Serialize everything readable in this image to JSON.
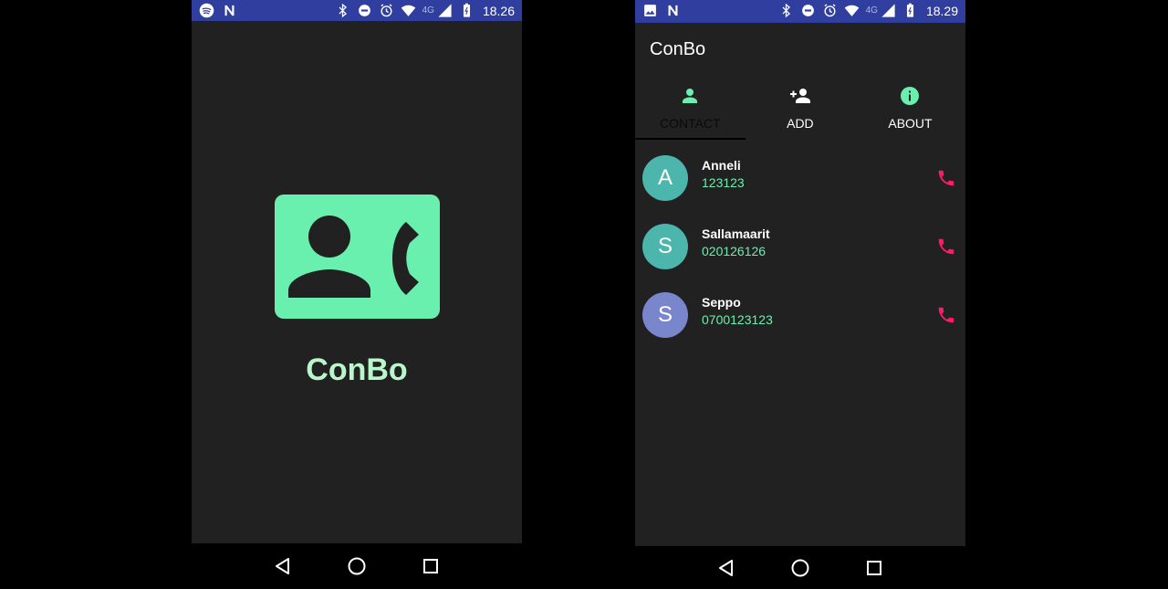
{
  "splash": {
    "status": {
      "time": "18.26",
      "network": "4G"
    },
    "app_name": "ConBo"
  },
  "main": {
    "status": {
      "time": "18.29",
      "network": "4G"
    },
    "app_title": "ConBo",
    "tabs": [
      {
        "label": "CONTACT",
        "icon": "person-icon",
        "active": true
      },
      {
        "label": "ADD",
        "icon": "person-add-icon",
        "active": false
      },
      {
        "label": "ABOUT",
        "icon": "info-icon",
        "active": false
      }
    ],
    "contacts": [
      {
        "initial": "A",
        "name": "Anneli",
        "number": "123123",
        "avatar_color": "#4db6ac"
      },
      {
        "initial": "S",
        "name": "Sallamaarit",
        "number": "020126126",
        "avatar_color": "#4db6ac"
      },
      {
        "initial": "S",
        "name": "Seppo",
        "number": "0700123123",
        "avatar_color": "#7986cb"
      }
    ]
  },
  "colors": {
    "accent": "#69f0ae",
    "call": "#ff1a6c",
    "status_bar": "#303f9f",
    "background": "#212121"
  }
}
